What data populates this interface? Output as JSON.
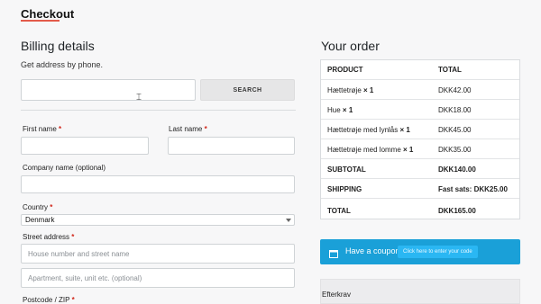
{
  "header": {
    "tab_label": "Checkout"
  },
  "billing": {
    "title": "Billing details",
    "subtitle": "Get address by phone.",
    "search_button": "SEARCH",
    "phone_placeholder": "",
    "first_name_label": "First name",
    "last_name_label": "Last name",
    "company_label": "Company name (optional)",
    "country_label": "Country",
    "country_value": "Denmark",
    "street_label": "Street address",
    "street_placeholder": "House number and street name",
    "street2_placeholder": "Apartment, suite, unit etc. (optional)",
    "postcode_label": "Postcode / ZIP",
    "required_mark": "*"
  },
  "order": {
    "title": "Your order",
    "headers": [
      "PRODUCT",
      "TOTAL"
    ],
    "items": [
      {
        "product": "Hættetrøje",
        "qty": "× 1",
        "total": "DKK42.00"
      },
      {
        "product": "Hue",
        "qty": "× 1",
        "total": "DKK18.00"
      },
      {
        "product": "Hættetrøje med lynlås",
        "qty": "× 1",
        "total": "DKK45.00"
      },
      {
        "product": "Hættetrøje med lomme",
        "qty": "× 1",
        "total": "DKK35.00"
      }
    ],
    "subtotal_label": "SUBTOTAL",
    "subtotal_value": "DKK140.00",
    "shipping_label": "SHIPPING",
    "shipping_value": "Fast sats: DKK25.00",
    "total_label": "TOTAL",
    "total_value": "DKK165.00"
  },
  "coupon": {
    "text": "Have a coupon?",
    "link": "Click here to enter your code"
  },
  "efterkrav": {
    "label": "Efterkrav"
  }
}
